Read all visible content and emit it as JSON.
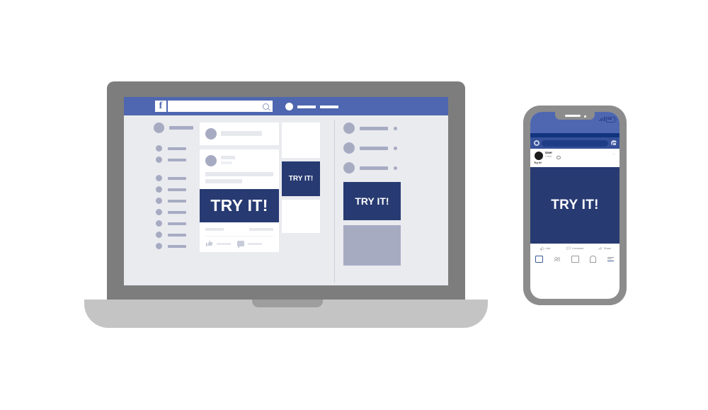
{
  "scene": {
    "title": "Facebook ad preview on laptop and smartphone",
    "ad_text": "TRY IT!"
  },
  "colors": {
    "fb_header_blue": "#4e67b0",
    "ad_navy": "#273a72",
    "page_bg": "#e9ebef",
    "placeholder_gray": "#a7abc2",
    "laptop_bezel": "#7d7d7d",
    "laptop_base": "#c4c4c4",
    "phone_frame": "#8c8c8c",
    "phone_strip": "#12347e",
    "phone_searchrow": "#355099"
  },
  "laptop": {
    "topbar": {
      "logo": "f",
      "search_placeholder": "",
      "search_icon": "search-icon",
      "nav_items": [
        "account-dot",
        "nav-line-1",
        "nav-line-2"
      ]
    },
    "left_sidebar": {
      "groups": [
        {
          "items": [
            {
              "size": "large"
            }
          ]
        },
        {
          "items": [
            {
              "size": "small"
            },
            {
              "size": "small"
            }
          ]
        },
        {
          "items": [
            {
              "size": "small"
            },
            {
              "size": "small"
            },
            {
              "size": "small"
            },
            {
              "size": "small"
            },
            {
              "size": "small"
            },
            {
              "size": "small"
            },
            {
              "size": "small"
            },
            {
              "size": "small"
            }
          ]
        }
      ]
    },
    "feed": {
      "composer": {
        "avatar": "avatar",
        "field": "status-placeholder"
      },
      "post": {
        "avatar": "avatar",
        "name_placeholder": "name-line",
        "meta_placeholder": "meta-line",
        "text_lines": [
          "text-line-long",
          "text-line-short"
        ],
        "image_text": "TRY IT!",
        "stats": [
          "reactions-count",
          "comments-count"
        ],
        "actions": [
          {
            "icon": "thumbs-up-icon",
            "label": ""
          },
          {
            "icon": "comment-icon",
            "label": ""
          }
        ]
      }
    },
    "ad_column": {
      "blocks": [
        {
          "type": "white"
        },
        {
          "type": "ad",
          "text": "TRY IT!"
        },
        {
          "type": "white"
        }
      ]
    },
    "right_sidebar": {
      "contacts": [
        {
          "avatar": "avatar",
          "name": "contact-line",
          "status": "online-dot"
        },
        {
          "avatar": "avatar",
          "name": "contact-line",
          "status": "online-dot"
        },
        {
          "avatar": "avatar",
          "name": "contact-line",
          "status": "online-dot"
        }
      ],
      "ad": {
        "text": "TRY IT!"
      },
      "placeholder_box": "gray-box"
    }
  },
  "phone": {
    "status_bar": {
      "signal_icon": "signal-bars-icon",
      "battery_icon": "battery-icon",
      "speaker": "earpiece-speaker",
      "camera": "front-camera"
    },
    "search_row": {
      "camera_icon": "camera-icon",
      "search_placeholder": "",
      "messenger_icon": "messenger-icon"
    },
    "post": {
      "avatar": "avatar",
      "author": "User",
      "timestamp": "2 min.",
      "privacy_icon": "globe-icon",
      "more_icon": "more-options-icon",
      "body_text": "Try it!",
      "image_text": "TRY IT!"
    },
    "actions": [
      {
        "icon": "thumbs-up-icon",
        "label": "Like"
      },
      {
        "icon": "comment-icon",
        "label": "Comment"
      },
      {
        "icon": "share-icon",
        "label": "Share"
      }
    ],
    "nav": [
      {
        "icon": "home-icon",
        "active": true
      },
      {
        "icon": "friends-icon",
        "active": false
      },
      {
        "icon": "marketplace-icon",
        "active": false
      },
      {
        "icon": "notifications-bell-icon",
        "active": false
      },
      {
        "icon": "menu-icon",
        "active": false
      }
    ]
  }
}
